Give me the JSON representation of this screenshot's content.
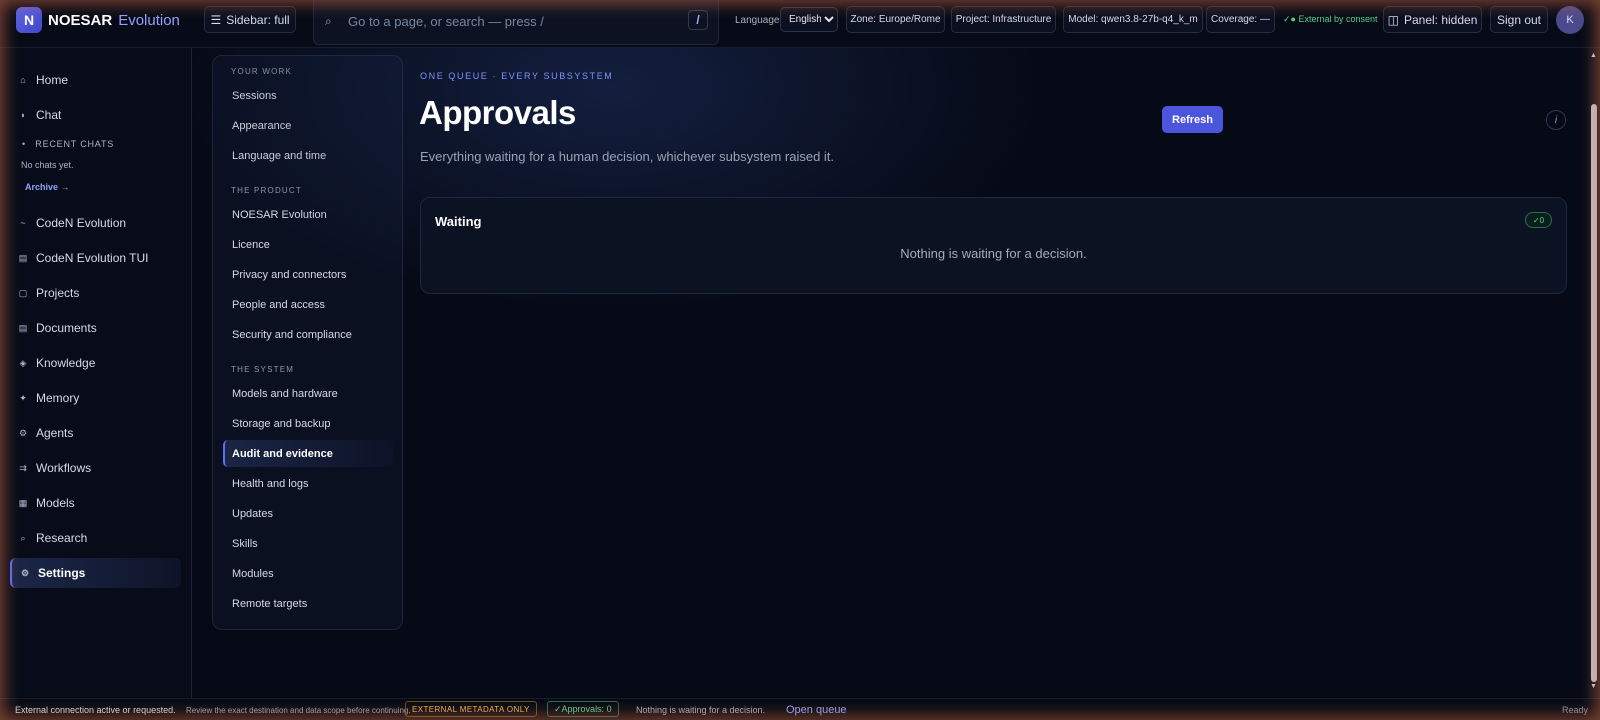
{
  "brand": {
    "badge": "N",
    "name": "NOESAR",
    "sub": "Evolution"
  },
  "topbar": {
    "sidebar_toggle": "Sidebar: full",
    "search_placeholder": "Go to a page, or search — press /",
    "search_key": "/",
    "language_label": "Language",
    "language_value": "English",
    "zone": "Zone: Europe/Rome",
    "project": "Project: Infrastructure",
    "model": "Model: qwen3.8-27b-q4_k_m",
    "coverage": "Coverage: —",
    "consent": "External by consent",
    "panel": "Panel: hidden",
    "signout": "Sign out",
    "avatar": "K"
  },
  "sidebar": {
    "items": [
      {
        "label": "Home",
        "icon": "⌂"
      },
      {
        "label": "Chat",
        "icon": "◗"
      },
      {
        "label": "CodeN Evolution",
        "icon": "~"
      },
      {
        "label": "CodeN Evolution TUI",
        "icon": "▤"
      },
      {
        "label": "Projects",
        "icon": "▢"
      },
      {
        "label": "Documents",
        "icon": "▤"
      },
      {
        "label": "Knowledge",
        "icon": "◈"
      },
      {
        "label": "Memory",
        "icon": "✦"
      },
      {
        "label": "Agents",
        "icon": "⚙"
      },
      {
        "label": "Workflows",
        "icon": "⇉"
      },
      {
        "label": "Models",
        "icon": "▦"
      },
      {
        "label": "Research",
        "icon": "⌕"
      },
      {
        "label": "Settings",
        "icon": "⚙"
      }
    ],
    "recent_heading": "RECENT CHATS",
    "recent_bullet": "•",
    "no_chats": "No chats yet.",
    "archive": "Archive →"
  },
  "settings_nav": {
    "sections": [
      {
        "heading": "YOUR WORK",
        "items": [
          "Sessions",
          "Appearance",
          "Language and time"
        ]
      },
      {
        "heading": "THE PRODUCT",
        "items": [
          "NOESAR Evolution",
          "Licence",
          "Privacy and connectors",
          "People and access",
          "Security and compliance"
        ]
      },
      {
        "heading": "THE SYSTEM",
        "items": [
          "Models and hardware",
          "Storage and backup",
          "Audit and evidence",
          "Health and logs",
          "Updates",
          "Skills",
          "Modules",
          "Remote targets"
        ]
      }
    ]
  },
  "main": {
    "eyebrow": "ONE QUEUE · EVERY SUBSYSTEM",
    "title": "Approvals",
    "subtitle": "Everything waiting for a human decision, whichever subsystem raised it.",
    "refresh": "Refresh",
    "info": "i",
    "card": {
      "title": "Waiting",
      "badge": "✓0",
      "empty": "Nothing is waiting for a decision."
    }
  },
  "statusbar": {
    "external_title": "External connection active or requested.",
    "external_body": "Review the exact destination and data scope before continuing.",
    "metadata": "EXTERNAL METADATA ONLY",
    "approvals": "✓Approvals: 0",
    "nothing": "Nothing is waiting for a decision.",
    "open_queue": "Open queue",
    "ready": "Ready"
  },
  "icons": {
    "menu": "hamburger-icon",
    "search": "search-icon",
    "consent": "check-dot-icon",
    "panel": "panel-icon"
  },
  "colors": {
    "accent": "#4c55dd",
    "success": "#55d494",
    "warning": "#f0b84a",
    "link": "#8fa2ff"
  }
}
